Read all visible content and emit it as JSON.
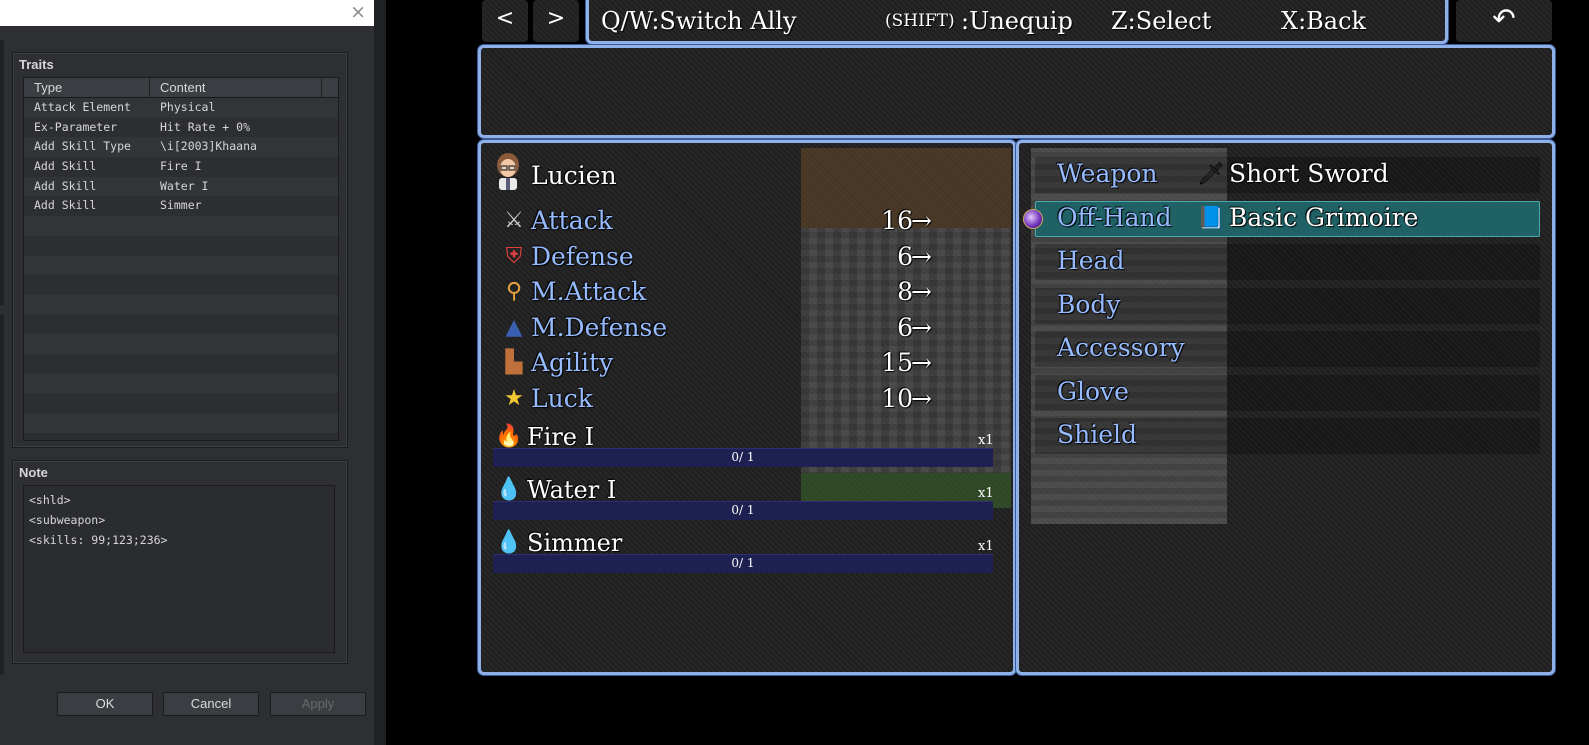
{
  "editor": {
    "traits_title": "Traits",
    "traits_columns": [
      "Type",
      "Content"
    ],
    "traits": [
      {
        "type": "Attack Element",
        "content": "Physical"
      },
      {
        "type": "Ex-Parameter",
        "content": "Hit Rate + 0%"
      },
      {
        "type": "Add Skill Type",
        "content": "\\i[2003]Khaana"
      },
      {
        "type": "Add Skill",
        "content": "Fire I"
      },
      {
        "type": "Add Skill",
        "content": "Water I"
      },
      {
        "type": "Add Skill",
        "content": "Simmer"
      }
    ],
    "note_title": "Note",
    "note_lines": [
      "<shld>",
      "<subweapon>",
      "<skills: 99;123;236>"
    ],
    "buttons": {
      "ok": "OK",
      "cancel": "Cancel",
      "apply": "Apply"
    },
    "close_icon": "×"
  },
  "game": {
    "nav_prev": "<",
    "nav_next": ">",
    "help": {
      "switch": "Q/W:Switch Ally",
      "shift_key": "(SHIFT)",
      "unequip": ":Unequip",
      "select": "Z:Select",
      "back": "X:Back"
    },
    "back_icon": "↶",
    "actor": {
      "name": "Lucien"
    },
    "stats": [
      {
        "icon": "sword-icon",
        "glyph": "⚔",
        "color": "#cfcfcf",
        "name": "Attack",
        "value": "16"
      },
      {
        "icon": "shield-icon",
        "glyph": "⛨",
        "color": "#e04040",
        "name": "Defense",
        "value": "6"
      },
      {
        "icon": "staff-icon",
        "glyph": "⚲",
        "color": "#e6a23c",
        "name": "M.Attack",
        "value": "8"
      },
      {
        "icon": "wizard-hat-icon",
        "glyph": "▲",
        "color": "#3a5fb0",
        "name": "M.Defense",
        "value": "6"
      },
      {
        "icon": "boots-icon",
        "glyph": "▙",
        "color": "#c0703a",
        "name": "Agility",
        "value": "15"
      },
      {
        "icon": "star-icon",
        "glyph": "★",
        "color": "#f2c830",
        "name": "Luck",
        "value": "10"
      }
    ],
    "arrow": "→",
    "skills": [
      {
        "icon": "fire-icon",
        "glyph": "🔥",
        "color": "#ff7a1a",
        "name": "Fire I",
        "mult": "x1",
        "progress": "0/ 1"
      },
      {
        "icon": "water-drop-icon",
        "glyph": "💧",
        "color": "#4aa8ff",
        "name": "Water I",
        "mult": "x1",
        "progress": "0/ 1"
      },
      {
        "icon": "water-drop-icon",
        "glyph": "💧",
        "color": "#4aa8ff",
        "name": "Simmer",
        "mult": "x1",
        "progress": "0/ 1"
      }
    ],
    "slots": [
      {
        "label": "Weapon",
        "item": "Short Sword",
        "item_icon": "sword-icon",
        "glyph": "🗡"
      },
      {
        "label": "Off-Hand",
        "item": "Basic Grimoire",
        "item_icon": "book-icon",
        "glyph": "📘"
      },
      {
        "label": "Head",
        "item": "",
        "item_icon": "",
        "glyph": ""
      },
      {
        "label": "Body",
        "item": "",
        "item_icon": "",
        "glyph": ""
      },
      {
        "label": "Accessory",
        "item": "",
        "item_icon": "",
        "glyph": ""
      },
      {
        "label": "Glove",
        "item": "",
        "item_icon": "",
        "glyph": ""
      },
      {
        "label": "Shield",
        "item": "",
        "item_icon": "",
        "glyph": ""
      }
    ],
    "selected_slot": 1
  }
}
